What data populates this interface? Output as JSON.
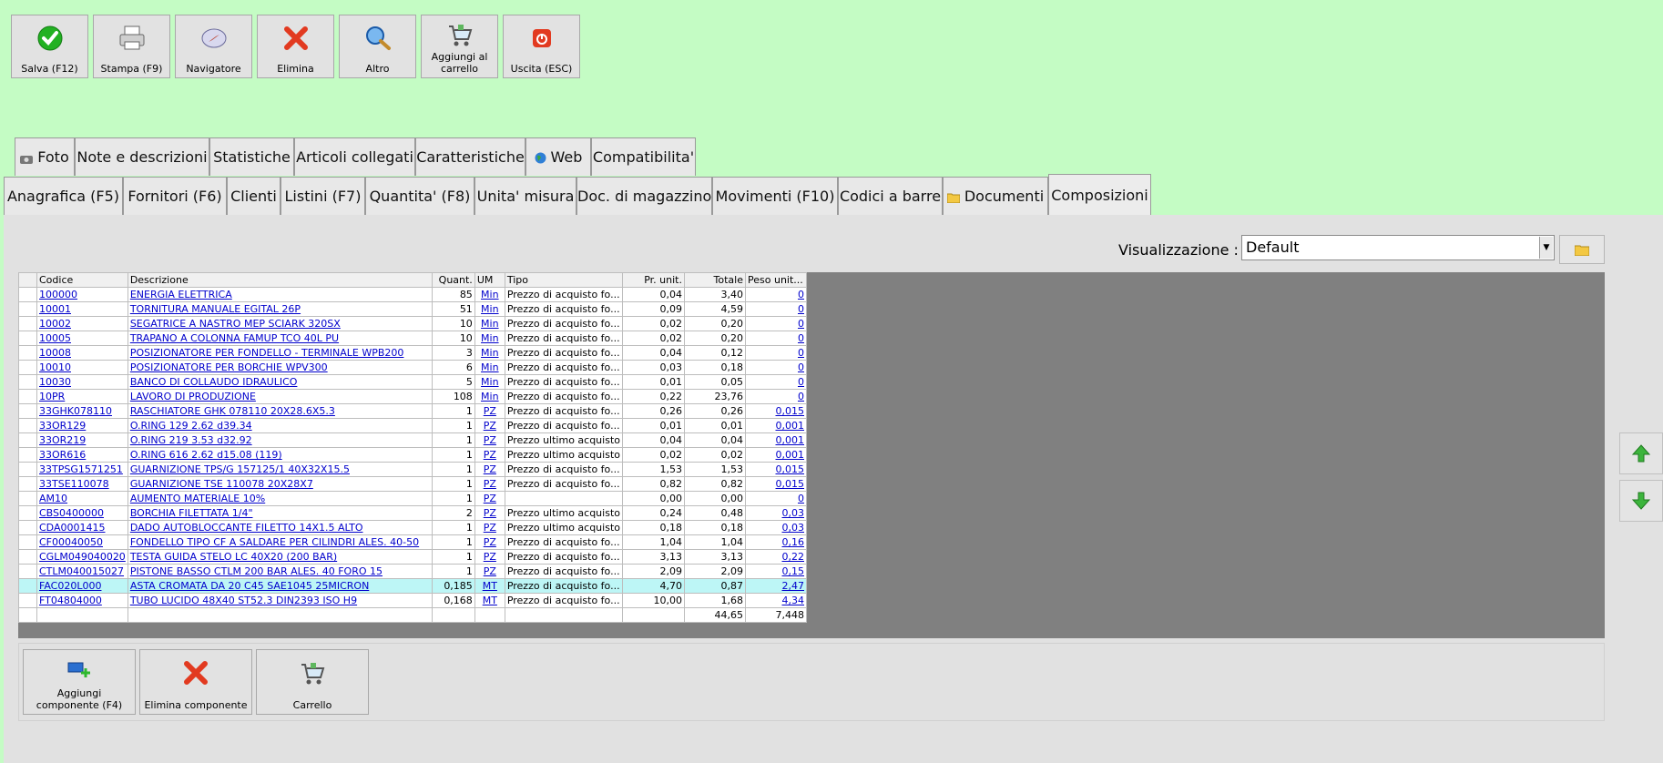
{
  "toolbar": {
    "save": "Salva (F12)",
    "print": "Stampa (F9)",
    "navigator": "Navigatore",
    "delete": "Elimina",
    "other": "Altro",
    "add_cart": "Aggiungi al carrello",
    "exit": "Uscita (ESC)"
  },
  "tabs_top": [
    "Foto",
    "Note e descrizioni",
    "Statistiche",
    "Articoli collegati",
    "Caratteristiche",
    "Web",
    "Compatibilita'"
  ],
  "tabs_bottom": [
    "Anagrafica (F5)",
    "Fornitori (F6)",
    "Clienti",
    "Listini (F7)",
    "Quantita' (F8)",
    "Unita' misura",
    "Doc. di magazzino",
    "Movimenti (F10)",
    "Codici a barre",
    "Documenti",
    "Composizioni"
  ],
  "view": {
    "label": "Visualizzazione :",
    "value": "Default"
  },
  "grid": {
    "headers": [
      "Codice",
      "Descrizione",
      "Quant.",
      "UM",
      "Tipo",
      "Pr. unit.",
      "Totale",
      "Peso unit..."
    ],
    "rows": [
      [
        "100000",
        "ENERGIA ELETTRICA",
        "85",
        "Min",
        "Prezzo di acquisto fo...",
        "0,04",
        "3,40",
        "0"
      ],
      [
        "10001",
        "TORNITURA MANUALE EGITAL 26P",
        "51",
        "Min",
        "Prezzo di acquisto fo...",
        "0,09",
        "4,59",
        "0"
      ],
      [
        "10002",
        "SEGATRICE A NASTRO MEP SCIARK 320SX",
        "10",
        "Min",
        "Prezzo di acquisto fo...",
        "0,02",
        "0,20",
        "0"
      ],
      [
        "10005",
        "TRAPANO A COLONNA FAMUP TCO 40L PU",
        "10",
        "Min",
        "Prezzo di acquisto fo...",
        "0,02",
        "0,20",
        "0"
      ],
      [
        "10008",
        "POSIZIONATORE PER FONDELLO - TERMINALE WPB200",
        "3",
        "Min",
        "Prezzo di acquisto fo...",
        "0,04",
        "0,12",
        "0"
      ],
      [
        "10010",
        "POSIZIONATORE PER BORCHIE WPV300",
        "6",
        "Min",
        "Prezzo di acquisto fo...",
        "0,03",
        "0,18",
        "0"
      ],
      [
        "10030",
        "BANCO DI COLLAUDO IDRAULICO",
        "5",
        "Min",
        "Prezzo di acquisto fo...",
        "0,01",
        "0,05",
        "0"
      ],
      [
        "10PR",
        "LAVORO DI PRODUZIONE",
        "108",
        "Min",
        "Prezzo di acquisto fo...",
        "0,22",
        "23,76",
        "0"
      ],
      [
        "33GHK078110",
        "RASCHIATORE GHK 078110 20X28.6X5.3",
        "1",
        "PZ",
        "Prezzo di acquisto fo...",
        "0,26",
        "0,26",
        "0,015"
      ],
      [
        "33OR129",
        "O.RING 129 2.62 d39.34",
        "1",
        "PZ",
        "Prezzo di acquisto fo...",
        "0,01",
        "0,01",
        "0,001"
      ],
      [
        "33OR219",
        "O.RING 219 3.53 d32.92",
        "1",
        "PZ",
        "Prezzo ultimo acquisto",
        "0,04",
        "0,04",
        "0,001"
      ],
      [
        "33OR616",
        "O.RING 616 2.62 d15.08 (119)",
        "1",
        "PZ",
        "Prezzo ultimo acquisto",
        "0,02",
        "0,02",
        "0,001"
      ],
      [
        "33TPSG1571251",
        "GUARNIZIONE TPS/G 157125/1 40X32X15.5",
        "1",
        "PZ",
        "Prezzo di acquisto fo...",
        "1,53",
        "1,53",
        "0,015"
      ],
      [
        "33TSE110078",
        "GUARNIZIONE TSE 110078 20X28X7",
        "1",
        "PZ",
        "Prezzo di acquisto fo...",
        "0,82",
        "0,82",
        "0,015"
      ],
      [
        "AM10",
        "AUMENTO MATERIALE 10%",
        "1",
        "PZ",
        "",
        "0,00",
        "0,00",
        "0"
      ],
      [
        "CBS0400000",
        "BORCHIA FILETTATA 1/4\"",
        "2",
        "PZ",
        "Prezzo ultimo acquisto",
        "0,24",
        "0,48",
        "0,03"
      ],
      [
        "CDA0001415",
        "DADO AUTOBLOCCANTE FILETTO 14X1.5 ALTO",
        "1",
        "PZ",
        "Prezzo ultimo acquisto",
        "0,18",
        "0,18",
        "0,03"
      ],
      [
        "CF00040050",
        "FONDELLO TIPO CF A SALDARE PER CILINDRI ALES. 40-50",
        "1",
        "PZ",
        "Prezzo di acquisto fo...",
        "1,04",
        "1,04",
        "0,16"
      ],
      [
        "CGLM049040020",
        "TESTA GUIDA STELO LC 40X20 (200 BAR)",
        "1",
        "PZ",
        "Prezzo di acquisto fo...",
        "3,13",
        "3,13",
        "0,22"
      ],
      [
        "CTLM040015027",
        "PISTONE BASSO CTLM 200 BAR ALES. 40 FORO 15",
        "1",
        "PZ",
        "Prezzo di acquisto fo...",
        "2,09",
        "2,09",
        "0,15"
      ],
      [
        "FAC020L000",
        "ASTA CROMATA DA 20 C45 SAE1045 25MICRON",
        "0,185",
        "MT",
        "Prezzo di acquisto fo...",
        "4,70",
        "0,87",
        "2,47"
      ],
      [
        "FT04804000",
        "TUBO LUCIDO 48X40 ST52.3 DIN2393 ISO H9",
        "0,168",
        "MT",
        "Prezzo di acquisto fo...",
        "10,00",
        "1,68",
        "4,34"
      ]
    ],
    "highlight_row": 20,
    "total": "44,65",
    "weight_total": "7,448"
  },
  "bottom": {
    "add_component": "Aggiungi componente (F4)",
    "delete_component": "Elimina componente",
    "cart": "Carrello"
  },
  "icons": [
    "check-icon",
    "printer-icon",
    "compass-icon",
    "red-x-icon",
    "magnifier-icon",
    "cart-icon",
    "power-icon",
    "camera-icon",
    "globe-icon",
    "folder-icon",
    "arrow-up-icon",
    "arrow-down-icon",
    "add-component-icon"
  ],
  "colors": {
    "background": "#c4fcc4",
    "grid_gray": "#808080",
    "link": "#0000cc",
    "highlight": "#bdf6f6"
  }
}
